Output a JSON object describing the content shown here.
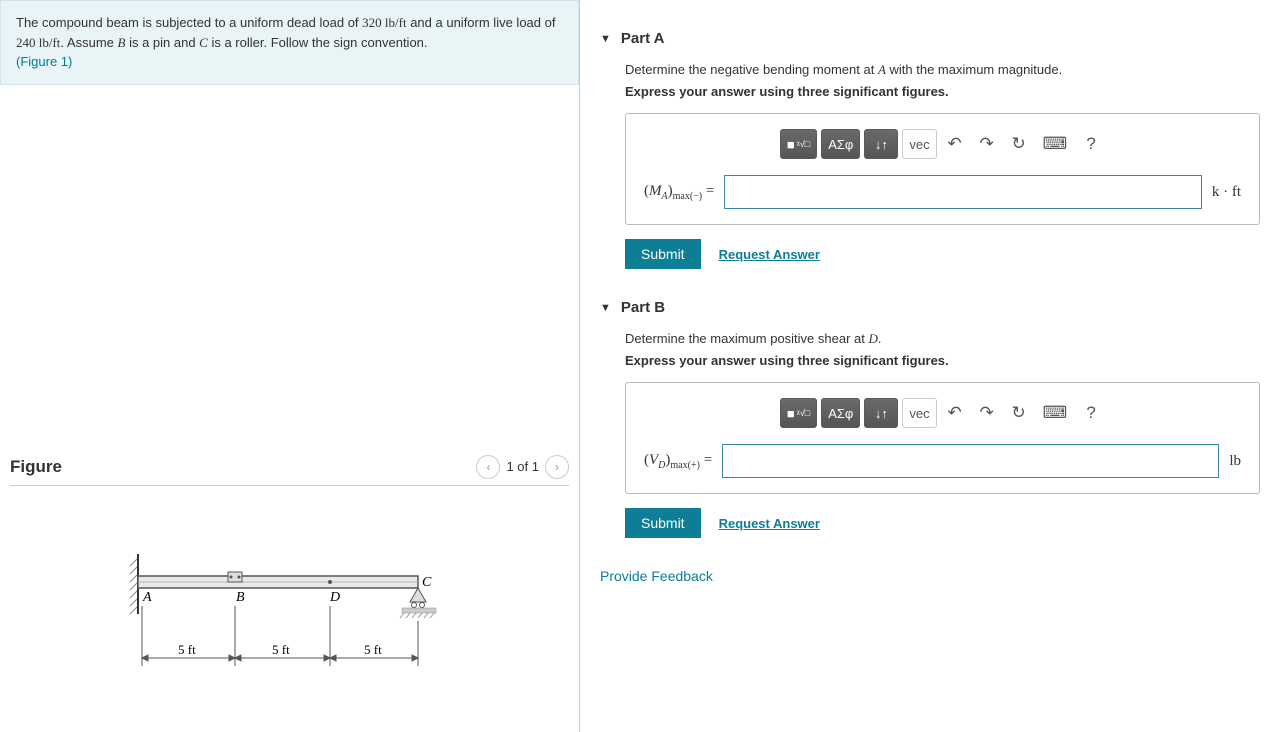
{
  "problem": {
    "line1_pre": "The compound beam is subjected to a uniform dead load of ",
    "dead_load": "320 lb/ft",
    "line1_mid": " and a uniform live load of ",
    "live_load": "240 lb/ft",
    "line1_post1": ". Assume ",
    "pin": "B",
    "line1_post2": " is a pin and ",
    "roller": "C",
    "line1_post3": " is a roller. Follow the sign convention.",
    "figure_link": "(Figure 1)"
  },
  "figure": {
    "title": "Figure",
    "counter": "1 of 1",
    "labels": {
      "A": "A",
      "B": "B",
      "C": "C",
      "D": "D"
    },
    "dims": {
      "d1": "5 ft",
      "d2": "5 ft",
      "d3": "5 ft"
    }
  },
  "toolbar": {
    "templates": "■",
    "root": "ᵡ√□",
    "greek": "ΑΣφ",
    "subsup": "↓↑",
    "vec": "vec",
    "undo": "↶",
    "redo": "↷",
    "reset": "↻",
    "keyboard": "⌨",
    "help": "?"
  },
  "partA": {
    "title": "Part A",
    "instr1_pre": "Determine the negative bending moment at ",
    "instr1_var": "A",
    "instr1_post": " with the maximum magnitude.",
    "instr2": "Express your answer using three significant figures.",
    "lhs_var": "M",
    "lhs_sub1": "A",
    "lhs_sub2": "max(−)",
    "equals": " = ",
    "unit": "k · ft",
    "submit": "Submit",
    "request": "Request Answer"
  },
  "partB": {
    "title": "Part B",
    "instr1_pre": "Determine the maximum positive shear at ",
    "instr1_var": "D",
    "instr1_post": ".",
    "instr2": "Express your answer using three significant figures.",
    "lhs_var": "V",
    "lhs_sub1": "D",
    "lhs_sub2": "max(+)",
    "equals": " = ",
    "unit": "lb",
    "submit": "Submit",
    "request": "Request Answer"
  },
  "feedback": "Provide Feedback"
}
